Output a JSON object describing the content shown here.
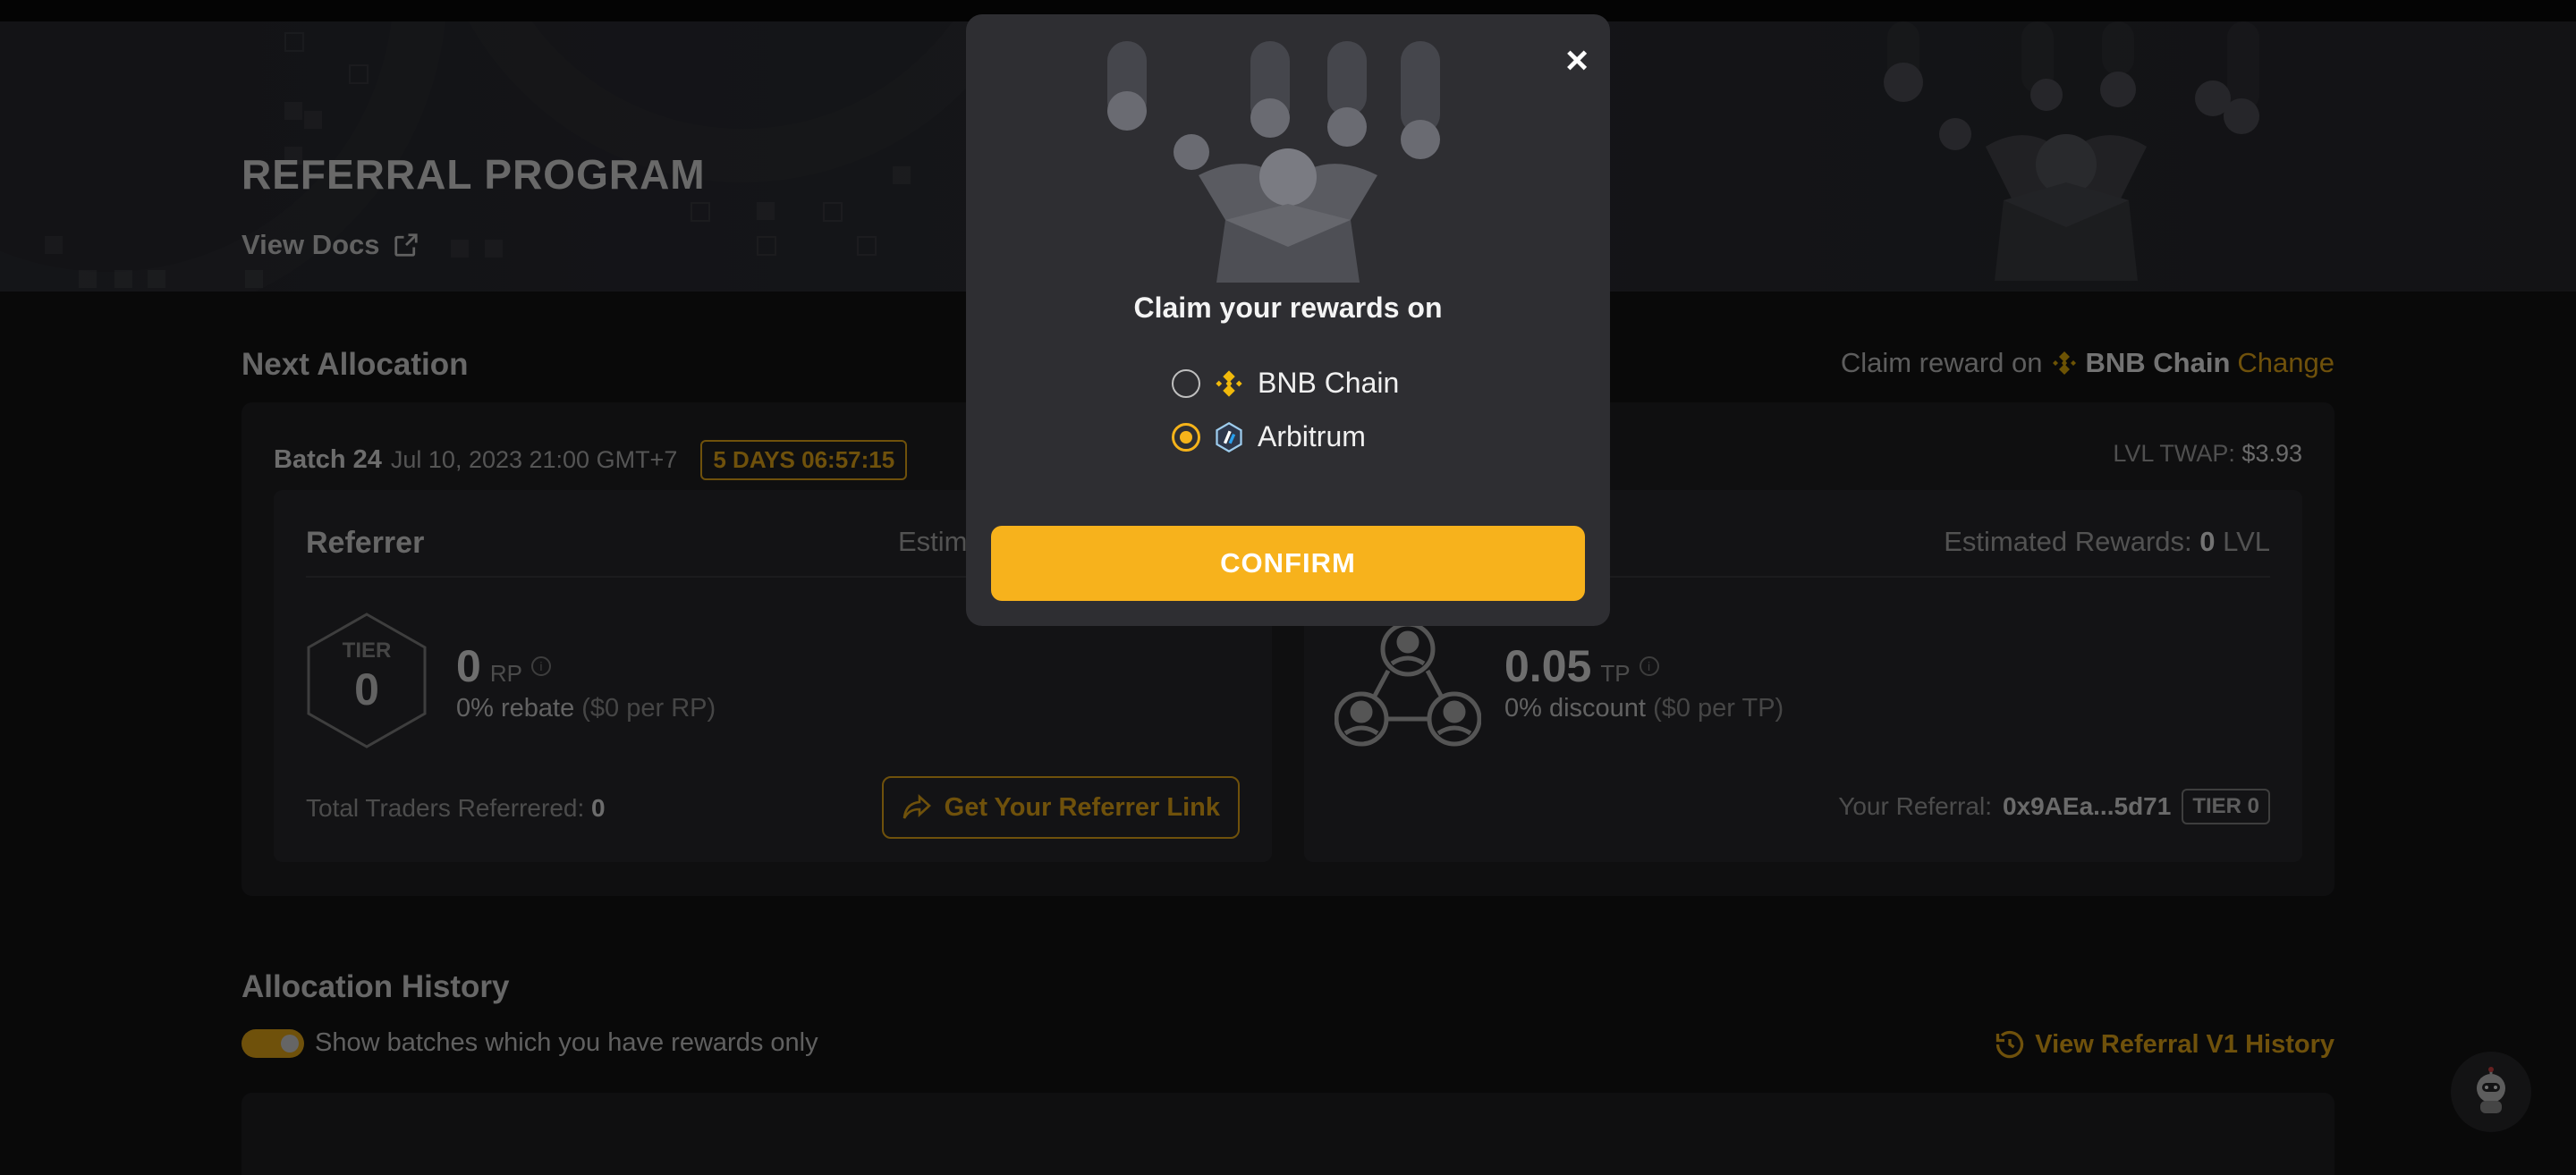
{
  "hero": {
    "title": "REFERRAL PROGRAM",
    "view_docs": "View Docs"
  },
  "next_allocation": {
    "title": "Next Allocation",
    "claim_prefix": "Claim reward on",
    "claim_chain": "BNB Chain",
    "change": "Change"
  },
  "batch": {
    "label": "Batch 24",
    "date": "Jul 10, 2023 21:00 GMT+7",
    "countdown": "5 DAYS 06:57:15",
    "twap_label": "LVL TWAP:",
    "twap_value": "$3.93"
  },
  "referrer": {
    "title": "Referrer",
    "est_label": "Estimated Rewards:",
    "tier_label": "TIER",
    "tier_value": "0",
    "points": "0",
    "points_unit": "RP",
    "rate": "0% rebate",
    "rate_detail": "($0 per RP)",
    "total_label": "Total Traders Referrered:",
    "total_value": "0",
    "link_button": "Get Your Referrer Link"
  },
  "trader": {
    "est_label": "Estimated Rewards:",
    "est_value": "0",
    "est_unit": "LVL",
    "points": "0.05",
    "points_unit": "TP",
    "rate": "0% discount",
    "rate_detail": "($0 per TP)",
    "your_ref_label": "Your Referral:",
    "your_ref_value": "0x9AEa...5d71",
    "tier_badge": "TIER 0"
  },
  "history": {
    "title": "Allocation History",
    "toggle_label": "Show batches which you have rewards only",
    "v1_link": "View Referral V1 History"
  },
  "modal": {
    "heading": "Claim your rewards on",
    "options": [
      {
        "label": "BNB Chain",
        "selected": false,
        "icon": "bnb-chain-icon"
      },
      {
        "label": "Arbitrum",
        "selected": true,
        "icon": "arbitrum-icon"
      }
    ],
    "confirm": "CONFIRM",
    "close": "×"
  },
  "colors": {
    "accent": "#f5b31a",
    "background": "#141414",
    "card": "#222225",
    "modal": "#2e2e32"
  }
}
